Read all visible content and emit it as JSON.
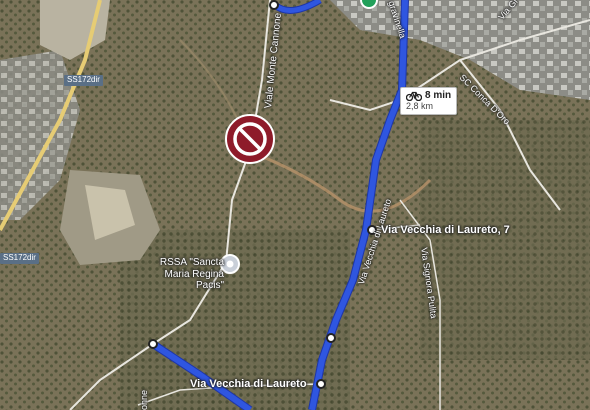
{
  "roads": [
    {
      "label": "Viale Monte Cannone"
    },
    {
      "label": "Via Vecchia di Laureto"
    },
    {
      "label": "Via Signora Pulita"
    },
    {
      "label": "SC Conca D'Oro"
    },
    {
      "label": "Via Gi"
    },
    {
      "label": "gravinella"
    },
    {
      "label": "onne"
    }
  ],
  "shields": [
    "SS172dir",
    "SS172dir"
  ],
  "places": [
    {
      "label": "Via Vecchia di Laureto, 7"
    },
    {
      "label": "Via Vecchia di Laureto"
    }
  ],
  "poi": {
    "name": "RSSA \"Sancta Maria Regina Pacis\"",
    "icon": "place-pin-icon"
  },
  "route_info": {
    "duration": "8 min",
    "distance": "2,8 km",
    "mode_icon": "bicycle-icon"
  },
  "restriction": {
    "icon": "no-entry-icon"
  },
  "colors": {
    "route": "#2f56e0",
    "route_outline": "#1e36a8",
    "no_entry": "#8e1b2a"
  }
}
